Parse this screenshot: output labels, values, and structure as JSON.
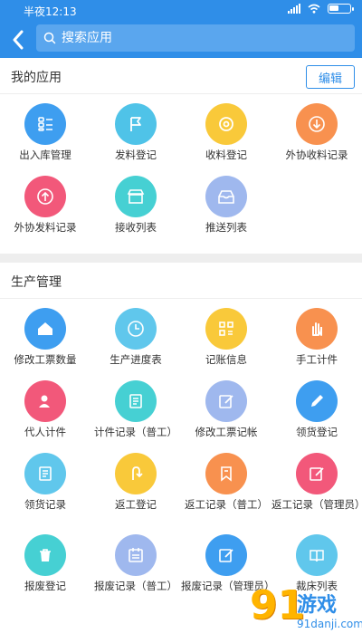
{
  "status_bar": {
    "time": "半夜12:13"
  },
  "search": {
    "placeholder": "搜索应用"
  },
  "my_apps": {
    "title": "我的应用",
    "edit_label": "编辑",
    "items": [
      {
        "label": "出入库管理",
        "icon": "list-icon",
        "color": "#3e9ef0"
      },
      {
        "label": "发料登记",
        "icon": "flag-icon",
        "color": "#4fc3e8"
      },
      {
        "label": "收料登记",
        "icon": "gear-icon",
        "color": "#f9c93a"
      },
      {
        "label": "外协收料记录",
        "icon": "download-icon",
        "color": "#f8914f"
      },
      {
        "label": "外协发料记录",
        "icon": "upload-icon",
        "color": "#f2587a"
      },
      {
        "label": "接收列表",
        "icon": "store-icon",
        "color": "#46d0d3"
      },
      {
        "label": "推送列表",
        "icon": "inbox-icon",
        "color": "#9fb8ee"
      }
    ]
  },
  "production": {
    "title": "生产管理",
    "items": [
      {
        "label": "修改工票数量",
        "icon": "home-icon",
        "color": "#3e9ef0"
      },
      {
        "label": "生产进度表",
        "icon": "clock-icon",
        "color": "#60c7ec"
      },
      {
        "label": "记账信息",
        "icon": "grid-icon",
        "color": "#f9c93a"
      },
      {
        "label": "手工计件",
        "icon": "hand-icon",
        "color": "#f8914f"
      },
      {
        "label": "代人计件",
        "icon": "user-icon",
        "color": "#f2587a"
      },
      {
        "label": "计件记录（普工）",
        "icon": "doc-icon",
        "color": "#46d0d3"
      },
      {
        "label": "修改工票记帐",
        "icon": "edit-icon",
        "color": "#9fb8ee"
      },
      {
        "label": "领货登记",
        "icon": "pencil-icon",
        "color": "#3e9ef0"
      },
      {
        "label": "领货记录",
        "icon": "doc-icon",
        "color": "#60c7ec"
      },
      {
        "label": "返工登记",
        "icon": "return-icon",
        "color": "#f9c93a"
      },
      {
        "label": "返工记录（普工）",
        "icon": "bookmark-icon",
        "color": "#f8914f"
      },
      {
        "label": "返工记录（管理员）",
        "icon": "edit-icon",
        "color": "#f2587a"
      },
      {
        "label": "报废登记",
        "icon": "trash-icon",
        "color": "#46d0d3"
      },
      {
        "label": "报废记录（普工）",
        "icon": "calendar-icon",
        "color": "#9fb8ee"
      },
      {
        "label": "报废记录（管理员）",
        "icon": "edit-icon",
        "color": "#3e9ef0"
      },
      {
        "label": "裁床列表",
        "icon": "book-icon",
        "color": "#60c7ec"
      }
    ]
  },
  "watermark": {
    "brand": "游戏",
    "url": "91danji.com",
    "number": "91"
  }
}
